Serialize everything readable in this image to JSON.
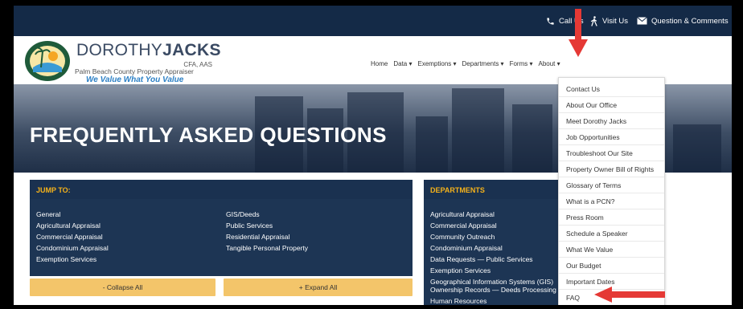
{
  "utility_bar": {
    "call_label": "Call Us",
    "visit_label": "Visit Us",
    "question_label": "Question & Comments"
  },
  "logo": {
    "name_light": "DOROTHY",
    "name_bold": "JACKS",
    "credentials": "CFA, AAS",
    "office": "Palm Beach County Property Appraiser",
    "tagline": "We Value What You Value",
    "seal_text": "PALM BEACH COUNTY PROPERTY APPRAISER"
  },
  "nav": {
    "items": [
      {
        "label": "Home"
      },
      {
        "label": "Data ▾"
      },
      {
        "label": "Exemptions ▾"
      },
      {
        "label": "Departments ▾"
      },
      {
        "label": "Forms ▾"
      },
      {
        "label": "About ▾"
      }
    ]
  },
  "hero": {
    "title": "FREQUENTLY ASKED QUESTIONS"
  },
  "jump_panel": {
    "heading": "JUMP TO:",
    "col1": [
      "General",
      "Agricultural Appraisal",
      "Commercial Appraisal",
      "Condominium Appraisal",
      "Exemption Services"
    ],
    "col2": [
      "GIS/Deeds",
      "Public Services",
      "Residential Appraisal",
      "Tangible Personal Property"
    ],
    "collapse_label": "- Collapse All",
    "expand_label": "+ Expand All"
  },
  "departments_panel": {
    "heading": "DEPARTMENTS",
    "items": [
      "Agricultural Appraisal",
      "Commercial Appraisal",
      "Community Outreach",
      "Condominium Appraisal",
      "Data Requests — Public Services",
      "Exemption Services",
      "Geographical Information Systems (GIS)",
      "Ownership Records — Deeds Processing",
      "Human Resources"
    ]
  },
  "about_dropdown": {
    "items": [
      "Contact Us",
      "About Our Office",
      "Meet Dorothy Jacks",
      "Job Opportunities",
      "Troubleshoot Our Site",
      "Property Owner Bill of Rights",
      "Glossary of Terms",
      "What is a PCN?",
      "Press Room",
      "Schedule a Speaker",
      "What We Value",
      "Our Budget",
      "Important Dates",
      "FAQ"
    ]
  },
  "colors": {
    "navy": "#142a47",
    "panel": "#1d3554",
    "heading_gold": "#f5b21a",
    "button_gold": "#f3c56a",
    "tagline_blue": "#2b7fc5",
    "arrow_red": "#e53935"
  }
}
